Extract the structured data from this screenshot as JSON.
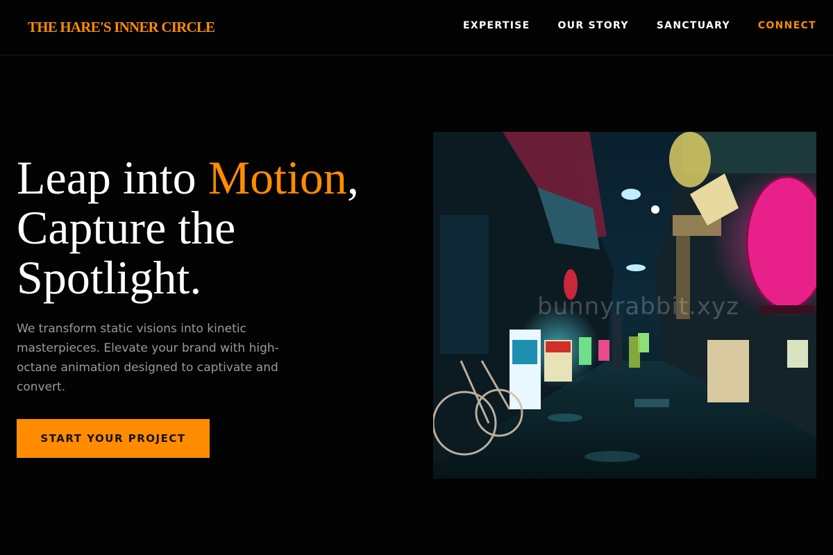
{
  "header": {
    "logo": "THE HARE'S INNER CIRCLE",
    "nav": [
      {
        "label": "EXPERTISE"
      },
      {
        "label": "OUR STORY"
      },
      {
        "label": "SANCTUARY"
      },
      {
        "label": "CONNECT"
      }
    ]
  },
  "hero": {
    "headline_part1": "Leap into ",
    "headline_highlight": "Motion",
    "headline_part2": ",",
    "headline_line2": "Capture the",
    "headline_line3": "Spotlight.",
    "subtext": "We transform static visions into kinetic masterpieces. Elevate your brand with high-octane animation designed to captivate and convert.",
    "cta_label": "START YOUR PROJECT",
    "image": {
      "watermark": "bunnyrabbit.xyz"
    }
  },
  "colors": {
    "accent": "#ff8c00",
    "background": "#030303",
    "text": "#ffffff",
    "muted_text": "#9a9a9a"
  }
}
